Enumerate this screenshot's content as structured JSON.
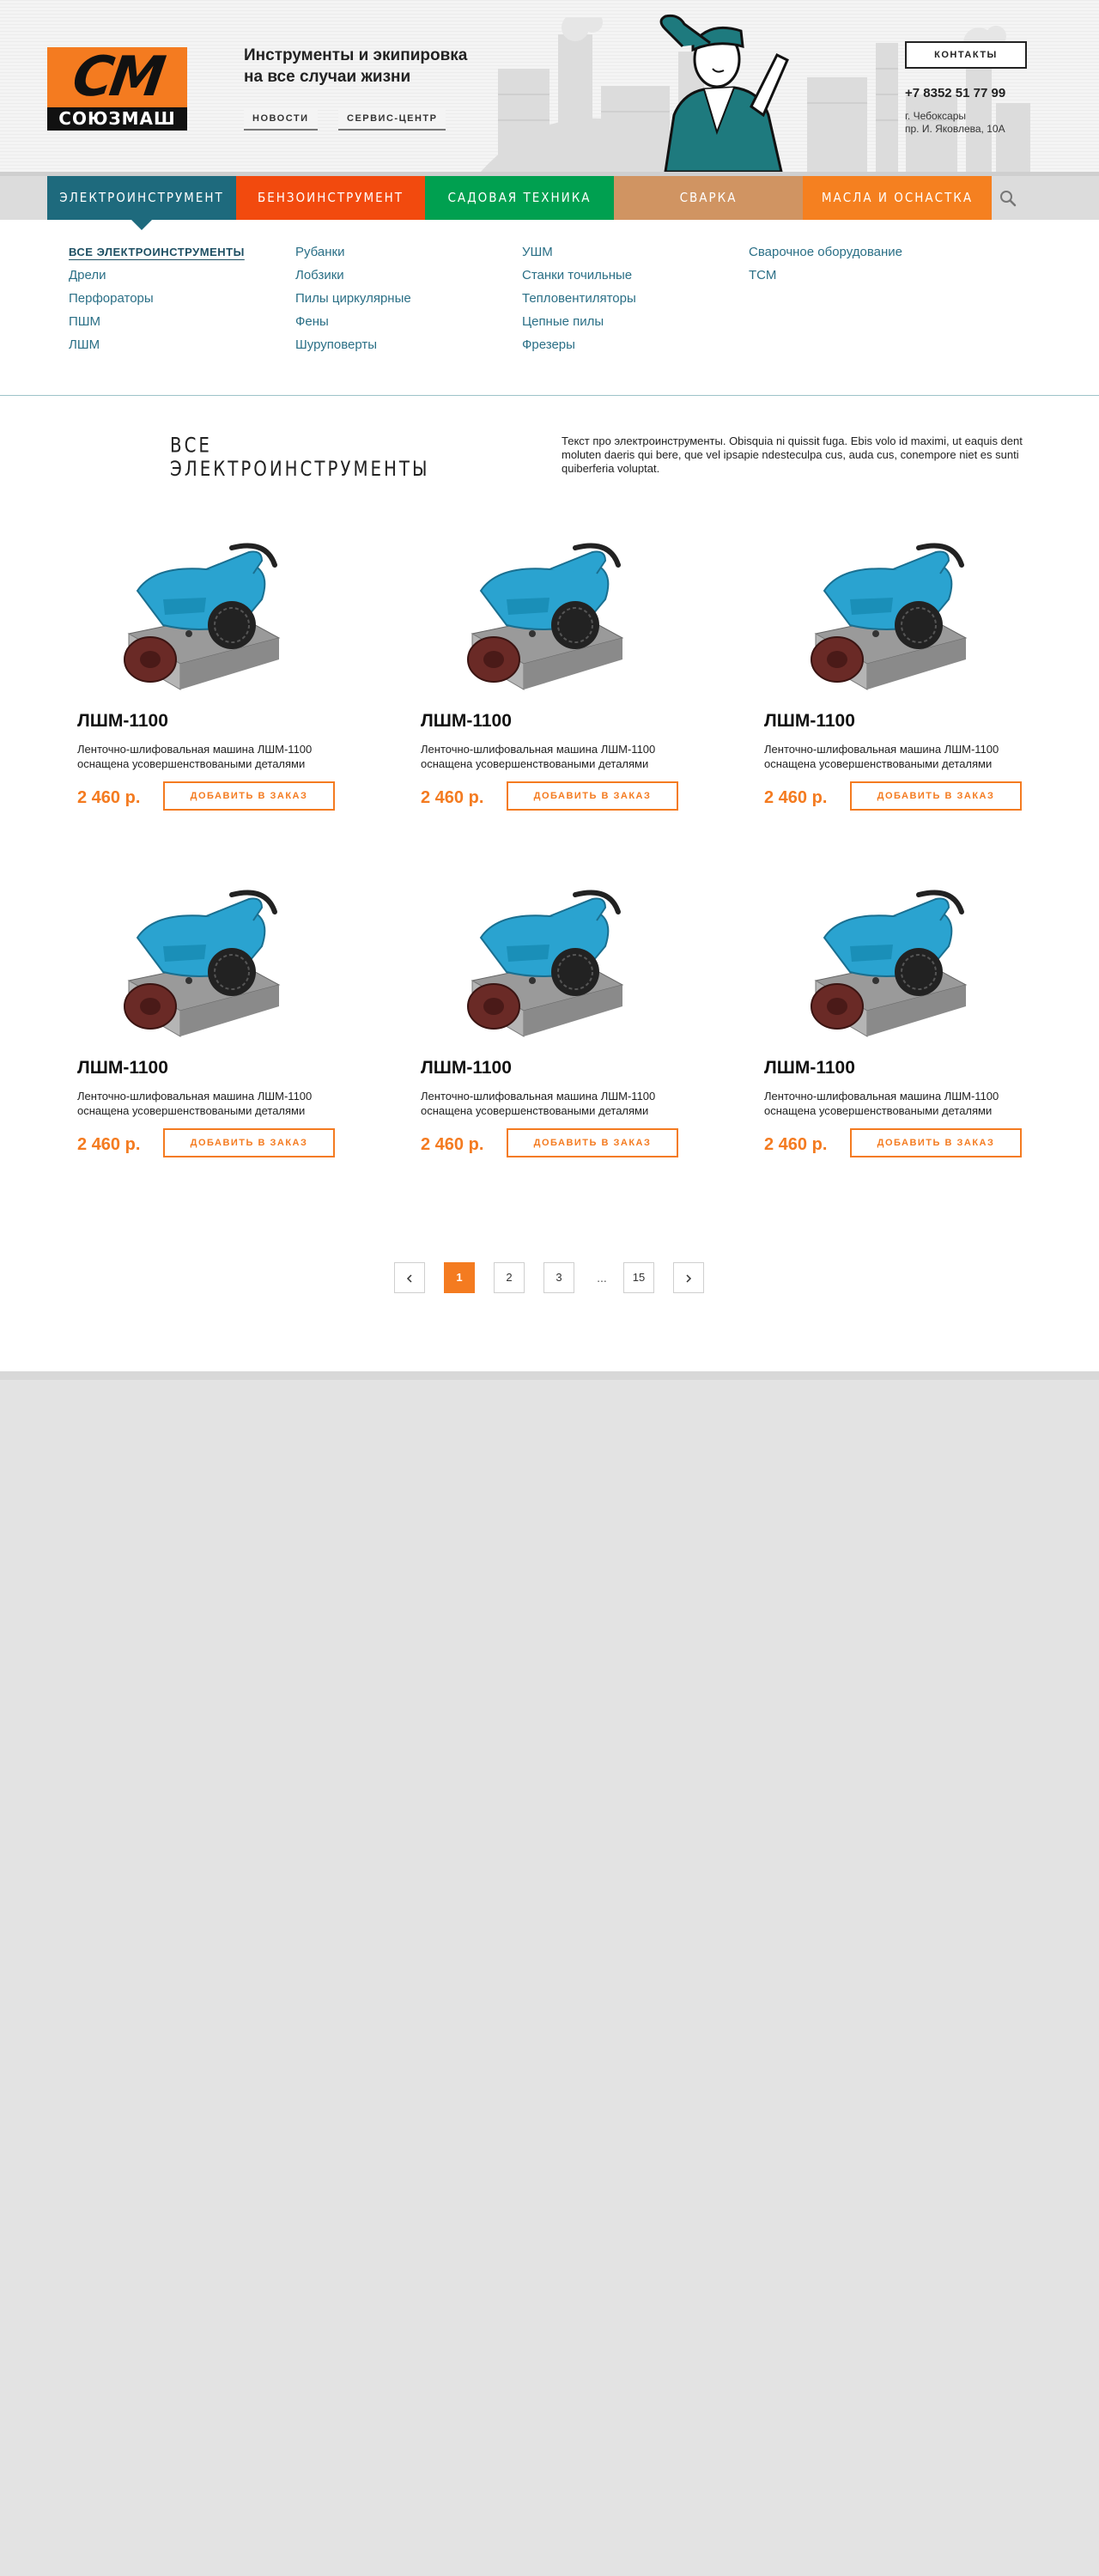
{
  "header": {
    "logo_mark": "СМ",
    "logo_text": "СОЮЗМАШ",
    "tagline": "Инструменты и экипировка\nна все случаи жизни",
    "links": [
      "Новости",
      "Сервис-центр"
    ],
    "contacts_label": "Контакты",
    "phone": "+7 8352 51 77 99",
    "address": "г. Чебоксары\nпр. И. Яковлева, 10А"
  },
  "nav": {
    "tabs": [
      {
        "label": "Электроинструмент",
        "color": "#1e6a7d",
        "active": true
      },
      {
        "label": "Бензоинструмент",
        "color": "#f24a0e",
        "active": false
      },
      {
        "label": "Садовая техника",
        "color": "#00a050",
        "active": false
      },
      {
        "label": "Сварка",
        "color": "#d09462",
        "active": false
      },
      {
        "label": "Масла и оснастка",
        "color": "#f58020",
        "active": false
      }
    ],
    "search_icon": "search-icon"
  },
  "submenu": {
    "columns": [
      [
        "Все электроинструменты",
        "Дрели",
        "Перфораторы",
        "ПШМ",
        "ЛШМ"
      ],
      [
        "Рубанки",
        "Лобзики",
        "Пилы циркулярные",
        "Фены",
        "Шуруповерты"
      ],
      [
        "УШМ",
        "Станки точильные",
        "Тепловентиляторы",
        "Цепные пилы",
        "Фрезеры"
      ],
      [
        "Сварочное оборудование",
        "ТСМ"
      ]
    ]
  },
  "section": {
    "title": "Все электроинструменты",
    "text": "Текст про электроинструменты. Obisquia ni quissit fuga. Ebis volo id maximi, ut eaquis dent moluten daeris qui bere, que vel ipsapie ndesteculpa cus, auda cus, conempore niet es sunti quiberferia voluptat."
  },
  "products": [
    {
      "name": "ЛШМ-1100",
      "desc": "Ленточно-шлифовальная машина ЛШМ-1100 оснащена усовершенствоваными деталями",
      "price": "2 460 р.",
      "button": "Добавить в заказ"
    },
    {
      "name": "ЛШМ-1100",
      "desc": "Ленточно-шлифовальная машина ЛШМ-1100 оснащена усовершенствоваными деталями",
      "price": "2 460 р.",
      "button": "Добавить в заказ"
    },
    {
      "name": "ЛШМ-1100",
      "desc": "Ленточно-шлифовальная машина ЛШМ-1100 оснащена усовершенствоваными деталями",
      "price": "2 460 р.",
      "button": "Добавить в заказ"
    },
    {
      "name": "ЛШМ-1100",
      "desc": "Ленточно-шлифовальная машина ЛШМ-1100 оснащена усовершенствоваными деталями",
      "price": "2 460 р.",
      "button": "Добавить в заказ"
    },
    {
      "name": "ЛШМ-1100",
      "desc": "Ленточно-шлифовальная машина ЛШМ-1100 оснащена усовершенствоваными деталями",
      "price": "2 460 р.",
      "button": "Добавить в заказ"
    },
    {
      "name": "ЛШМ-1100",
      "desc": "Ленточно-шлифовальная машина ЛШМ-1100 оснащена усовершенствоваными деталями",
      "price": "2 460 р.",
      "button": "Добавить в заказ"
    }
  ],
  "pagination": {
    "prev_icon": "chevron-left-icon",
    "pages": [
      "1",
      "2",
      "3",
      "15"
    ],
    "current": "1",
    "ellipsis": "...",
    "next_icon": "chevron-right-icon"
  },
  "colors": {
    "accent": "#f47b20",
    "link": "#2a6f86"
  }
}
